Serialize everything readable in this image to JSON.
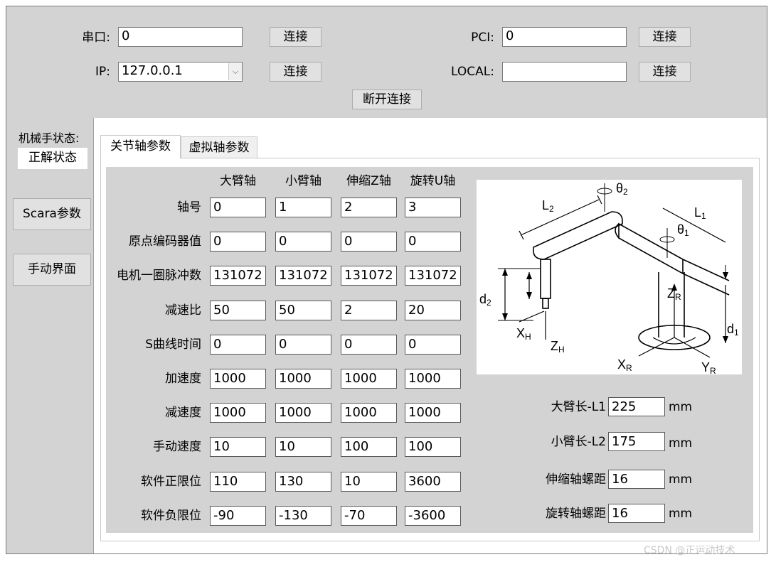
{
  "connection": {
    "serial_label": "串口:",
    "serial_value": "0",
    "ip_label": "IP:",
    "ip_value": "127.0.0.1",
    "pci_label": "PCI:",
    "pci_value": "0",
    "local_label": "LOCAL:",
    "local_value": "",
    "connect_label": "连接",
    "disconnect_label": "断开连接"
  },
  "sidebar": {
    "status_label": "机械手状态:",
    "status_value": "正解状态",
    "scara_button": "Scara参数",
    "manual_button": "手动界面"
  },
  "tabs": [
    {
      "label": "关节轴参数",
      "active": true
    },
    {
      "label": "虚拟轴参数",
      "active": false
    }
  ],
  "table": {
    "columns": [
      "大臂轴",
      "小臂轴",
      "伸缩Z轴",
      "旋转U轴"
    ],
    "rows": [
      {
        "label": "轴号",
        "values": [
          "0",
          "1",
          "2",
          "3"
        ]
      },
      {
        "label": "原点编码器值",
        "values": [
          "0",
          "0",
          "0",
          "0"
        ]
      },
      {
        "label": "电机一圈脉冲数",
        "values": [
          "131072",
          "131072",
          "131072",
          "131072"
        ]
      },
      {
        "label": "减速比",
        "values": [
          "50",
          "50",
          "2",
          "20"
        ]
      },
      {
        "label": "S曲线时间",
        "values": [
          "0",
          "0",
          "0",
          "0"
        ]
      },
      {
        "label": "加速度",
        "values": [
          "1000",
          "1000",
          "1000",
          "1000"
        ]
      },
      {
        "label": "减速度",
        "values": [
          "1000",
          "1000",
          "1000",
          "1000"
        ]
      },
      {
        "label": "手动速度",
        "values": [
          "10",
          "10",
          "100",
          "100"
        ]
      },
      {
        "label": "软件正限位",
        "values": [
          "110",
          "130",
          "10",
          "3600"
        ]
      },
      {
        "label": "软件负限位",
        "values": [
          "-90",
          "-130",
          "-70",
          "-3600"
        ]
      }
    ]
  },
  "diagram": {
    "labels": {
      "theta2": "θ",
      "theta2_sub": "2",
      "theta1": "θ",
      "theta1_sub": "1",
      "l2": "L",
      "l2_sub": "2",
      "l1": "L",
      "l1_sub": "1",
      "d2": "d",
      "d2_sub": "2",
      "d1": "d",
      "d1_sub": "1",
      "zr": "Z",
      "zr_sub": "R",
      "xh": "X",
      "xh_sub": "H",
      "zh": "Z",
      "zh_sub": "H",
      "xr": "X",
      "xr_sub": "R",
      "yr": "Y",
      "yr_sub": "R"
    }
  },
  "params": [
    {
      "label": "大臂长-L1",
      "value": "225",
      "unit": "mm"
    },
    {
      "label": "小臂长-L2",
      "value": "175",
      "unit": "mm"
    },
    {
      "label": "伸缩轴螺距",
      "value": "16",
      "unit": "mm"
    },
    {
      "label": "旋转轴螺距",
      "value": "16",
      "unit": "mm"
    }
  ],
  "watermark": "CSDN @正运动技术"
}
